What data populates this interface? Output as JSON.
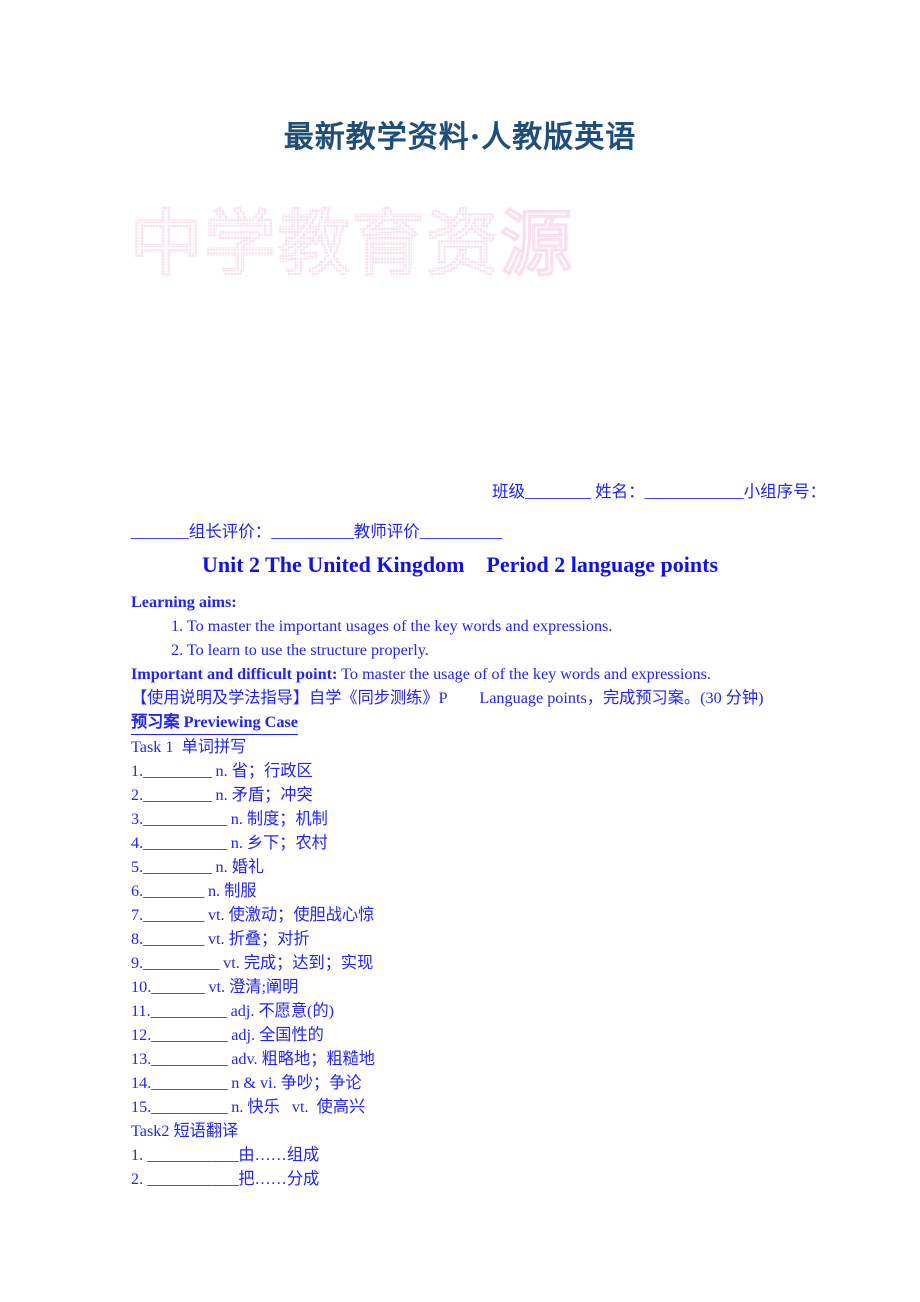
{
  "header": {
    "banner": "最新教学资料·人教版英语"
  },
  "watermark": {
    "text": "中学教育资源"
  },
  "form": {
    "line1": "班级________ 姓名：____________小组序号：",
    "line2": "_______组长评价：__________教师评价__________"
  },
  "title": {
    "text": "Unit 2 The United Kingdom    Period 2 language points"
  },
  "learning_aims": {
    "heading": "Learning aims:",
    "items": [
      "1. To master the important usages of the key words and expressions.",
      "2. To learn to use the structure properly."
    ]
  },
  "important_point": {
    "label": "Important and difficult point:",
    "text": " To master the usage of of the key words and expressions."
  },
  "instruction": {
    "text": "【使用说明及学法指导】自学《同步测练》P　　Language points，完成预习案。(30 分钟)"
  },
  "previewing_case": {
    "heading": "预习案 Previewing Case"
  },
  "task1": {
    "heading": "Task 1  单词拼写",
    "items": [
      {
        "num": "1.",
        "blank": "_________",
        "pos": " n.",
        "meaning": " 省；行政区"
      },
      {
        "num": "2.",
        "blank": "_________",
        "pos": " n.",
        "meaning": " 矛盾；冲突"
      },
      {
        "num": "3.",
        "blank": "___________",
        "pos": " n.",
        "meaning": " 制度；机制"
      },
      {
        "num": "4.",
        "blank": "___________",
        "pos": " n.",
        "meaning": " 乡下；农村"
      },
      {
        "num": "5.",
        "blank": "_________",
        "pos": " n.",
        "meaning": " 婚礼"
      },
      {
        "num": "6.",
        "blank": "________",
        "pos": " n.",
        "meaning": " 制服"
      },
      {
        "num": "7.",
        "blank": "________",
        "pos": " vt.",
        "meaning": " 使激动；使胆战心惊"
      },
      {
        "num": "8.",
        "blank": "________",
        "pos": " vt.",
        "meaning": " 折叠；对折"
      },
      {
        "num": "9.",
        "blank": "__________",
        "pos": " vt.",
        "meaning": " 完成；达到；实现"
      },
      {
        "num": "10.",
        "blank": "_______",
        "pos": " vt.",
        "meaning": " 澄清;阐明"
      },
      {
        "num": "11.",
        "blank": "__________",
        "pos": " adj.",
        "meaning": " 不愿意(的)"
      },
      {
        "num": "12.",
        "blank": "__________",
        "pos": " adj.",
        "meaning": " 全国性的"
      },
      {
        "num": "13.",
        "blank": "__________",
        "pos": " adv.",
        "meaning": " 粗略地；粗糙地"
      },
      {
        "num": "14.",
        "blank": "__________",
        "pos": " n & vi.",
        "meaning": " 争吵；争论"
      },
      {
        "num": "15.",
        "blank": "__________",
        "pos": " n.",
        "meaning": " 快乐   vt.  使高兴"
      }
    ]
  },
  "task2": {
    "heading": "Task2 短语翻译",
    "items": [
      {
        "num": "1.",
        "blank": "____________",
        "meaning": "由……组成"
      },
      {
        "num": "2.",
        "blank": "____________",
        "meaning": "把……分成"
      }
    ]
  },
  "colors": {
    "body_text": "#2424ee",
    "title": "#1111e8",
    "header_banner": "#1f4e79",
    "watermark": "#f0a8c8"
  }
}
